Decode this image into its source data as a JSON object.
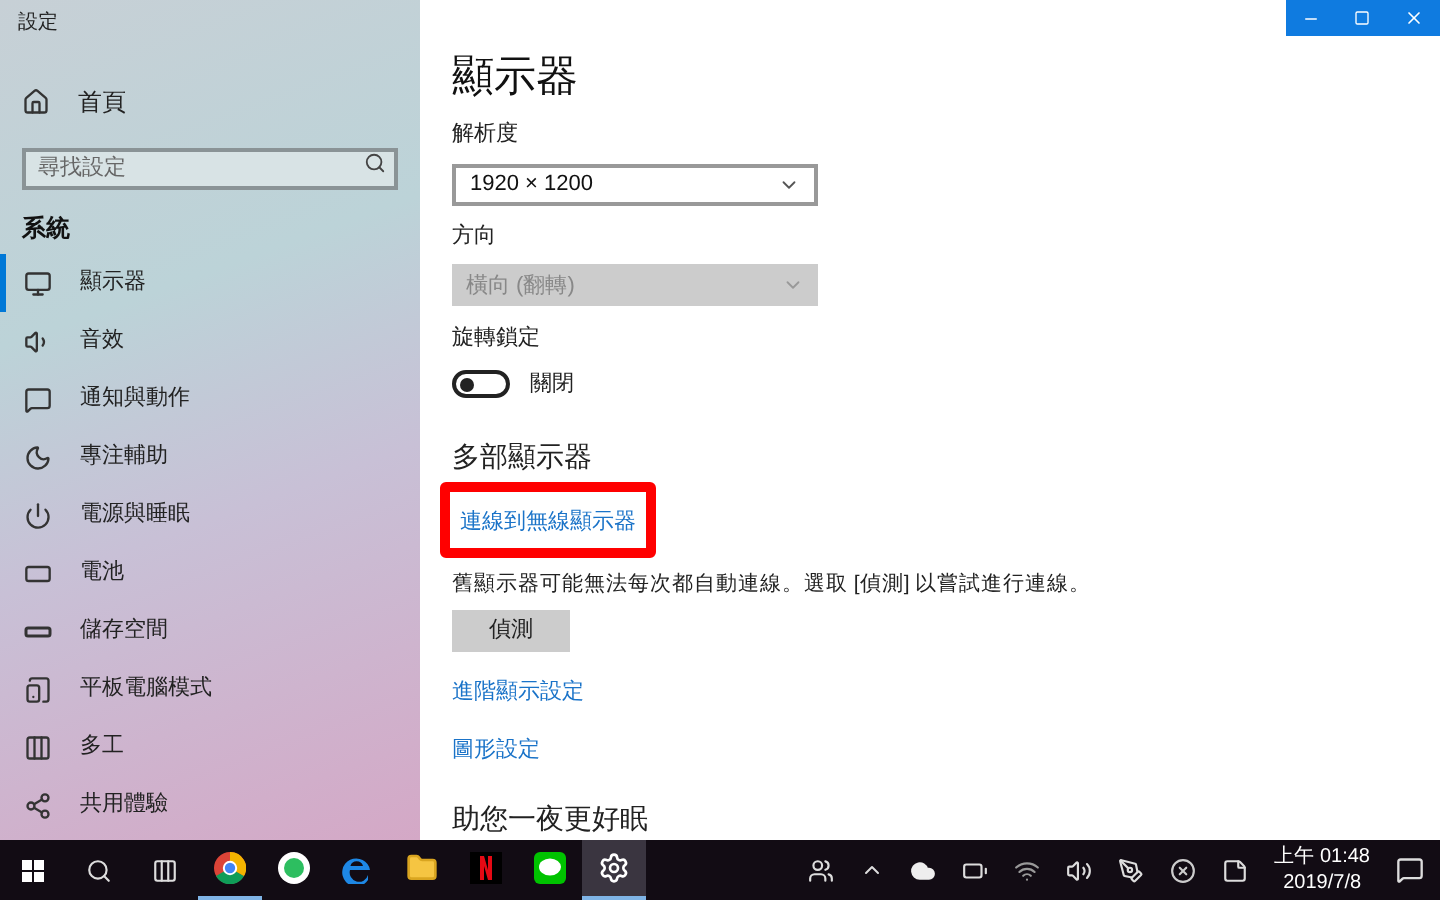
{
  "window": {
    "title": "設定"
  },
  "sidebar": {
    "home": "首頁",
    "search": {
      "placeholder": "尋找設定"
    },
    "section": "系統",
    "items": [
      {
        "kind": "display",
        "label": "顯示器",
        "selected": true
      },
      {
        "kind": "sound",
        "label": "音效",
        "selected": false
      },
      {
        "kind": "notifications",
        "label": "通知與動作",
        "selected": false
      },
      {
        "kind": "focus",
        "label": "專注輔助",
        "selected": false
      },
      {
        "kind": "power",
        "label": "電源與睡眠",
        "selected": false
      },
      {
        "kind": "battery",
        "label": "電池",
        "selected": false
      },
      {
        "kind": "storage",
        "label": "儲存空間",
        "selected": false
      },
      {
        "kind": "tablet",
        "label": "平板電腦模式",
        "selected": false
      },
      {
        "kind": "multitask",
        "label": "多工",
        "selected": false
      },
      {
        "kind": "share",
        "label": "共用體驗",
        "selected": false
      }
    ]
  },
  "main": {
    "title": "顯示器",
    "resolution": {
      "label": "解析度",
      "value": "1920 × 1200",
      "disabled": false
    },
    "orientation": {
      "label": "方向",
      "value": "橫向 (翻轉)",
      "disabled": true
    },
    "rotation_lock": {
      "label": "旋轉鎖定",
      "on": false,
      "state_text": "關閉"
    },
    "multi_heading": "多部顯示器",
    "wireless_link": {
      "label": "連線到無線顯示器",
      "highlighted": true
    },
    "detect_note": "舊顯示器可能無法每次都自動連線。選取 [偵測] 以嘗試進行連線。",
    "detect_button": "偵測",
    "links": [
      "進階顯示設定",
      "圖形設定"
    ],
    "sleep_heading": "助您一夜更好眠"
  },
  "taskbar": {
    "apps": [
      {
        "kind": "chrome",
        "running": true,
        "selected": false
      },
      {
        "kind": "evernote",
        "running": false,
        "selected": false
      },
      {
        "kind": "edge",
        "running": false,
        "selected": false
      },
      {
        "kind": "explorer",
        "running": false,
        "selected": false
      },
      {
        "kind": "netflix",
        "running": false,
        "selected": false
      },
      {
        "kind": "line",
        "running": false,
        "selected": false
      },
      {
        "kind": "settings",
        "running": true,
        "selected": true
      }
    ],
    "time": "上午 01:48",
    "date": "2019/7/8"
  }
}
